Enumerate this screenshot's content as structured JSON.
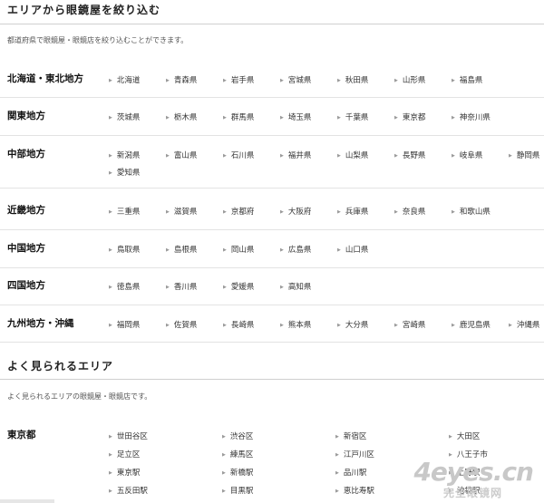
{
  "prefecture_section": {
    "title": "エリアから眼鏡屋を絞り込む",
    "description": "都道府県で眼鏡屋・眼鏡店を絞り込むことができます。",
    "regions": [
      {
        "name": "北海道・東北地方",
        "prefs": [
          "北海道",
          "青森県",
          "岩手県",
          "宮城県",
          "秋田県",
          "山形県",
          "福島県"
        ]
      },
      {
        "name": "関東地方",
        "prefs": [
          "茨城県",
          "栃木県",
          "群馬県",
          "埼玉県",
          "千葉県",
          "東京都",
          "神奈川県"
        ]
      },
      {
        "name": "中部地方",
        "prefs": [
          "新潟県",
          "富山県",
          "石川県",
          "福井県",
          "山梨県",
          "長野県",
          "岐阜県",
          "静岡県",
          "愛知県"
        ]
      },
      {
        "name": "近畿地方",
        "prefs": [
          "三重県",
          "滋賀県",
          "京都府",
          "大阪府",
          "兵庫県",
          "奈良県",
          "和歌山県"
        ]
      },
      {
        "name": "中国地方",
        "prefs": [
          "鳥取県",
          "島根県",
          "岡山県",
          "広島県",
          "山口県"
        ]
      },
      {
        "name": "四国地方",
        "prefs": [
          "徳島県",
          "香川県",
          "愛媛県",
          "高知県"
        ]
      },
      {
        "name": "九州地方・沖縄",
        "prefs": [
          "福岡県",
          "佐賀県",
          "長崎県",
          "熊本県",
          "大分県",
          "宮崎県",
          "鹿児島県",
          "沖縄県"
        ]
      }
    ]
  },
  "popular_section": {
    "title": "よく見られるエリア",
    "description": "よく見られるエリアの眼鏡屋・眼鏡店です。",
    "areas": [
      {
        "name": "東京都",
        "items": [
          "世田谷区",
          "渋谷区",
          "新宿区",
          "大田区",
          "足立区",
          "練馬区",
          "江戸川区",
          "八王子市",
          "東京駅",
          "新橋駅",
          "品川駅",
          "上野駅",
          "五反田駅",
          "目黒駅",
          "恵比寿駅",
          "池袋駅"
        ]
      }
    ]
  },
  "watermark": {
    "brand": "4eyes.cn",
    "sub": "完全眼镜网"
  }
}
